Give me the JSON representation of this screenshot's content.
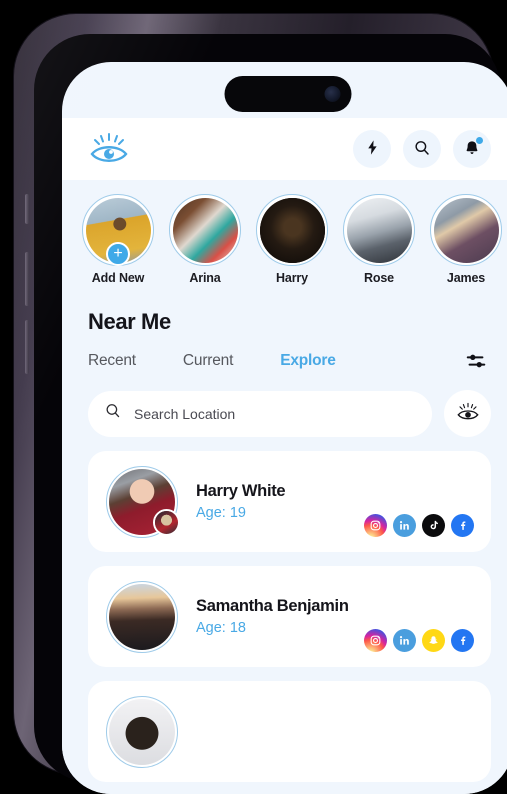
{
  "app": {
    "brand_icon": "eye-logo-icon",
    "accent_color": "#49a9e5",
    "background_color": "#f0f6fd"
  },
  "header": {
    "actions": [
      {
        "name": "flash-icon",
        "label": "Flash"
      },
      {
        "name": "search-icon",
        "label": "Search"
      },
      {
        "name": "bell-icon",
        "label": "Notifications",
        "has_dot": true
      }
    ]
  },
  "stories": {
    "items": [
      {
        "label": "Add New",
        "photo": "ph-addnew",
        "add_badge": "+"
      },
      {
        "label": "Arina",
        "photo": "ph-arina"
      },
      {
        "label": "Harry",
        "photo": "ph-harry"
      },
      {
        "label": "Rose",
        "photo": "ph-rose"
      },
      {
        "label": "James",
        "photo": "ph-james"
      }
    ]
  },
  "section": {
    "title": "Near Me",
    "tabs": [
      {
        "label": "Recent",
        "active": false
      },
      {
        "label": "Current",
        "active": false
      },
      {
        "label": "Explore",
        "active": true
      }
    ],
    "filter_icon": "filter-sliders-icon"
  },
  "search": {
    "placeholder": "Search Location",
    "value": "",
    "icon": "search-icon",
    "side_button_icon": "eye-icon"
  },
  "people": [
    {
      "name": "Harry White",
      "age_label": "Age: 19",
      "photo": "ph-harrywhite",
      "badge_photo": "ph-badge1",
      "socials": [
        "instagram",
        "linkedin",
        "tiktok",
        "facebook"
      ]
    },
    {
      "name": "Samantha Benjamin",
      "age_label": "Age: 18",
      "photo": "ph-samantha",
      "badge_photo": null,
      "socials": [
        "instagram",
        "linkedin",
        "snapchat",
        "facebook"
      ]
    },
    {
      "name": "",
      "age_label": "",
      "photo": "ph-next",
      "badge_photo": null,
      "socials": []
    }
  ]
}
